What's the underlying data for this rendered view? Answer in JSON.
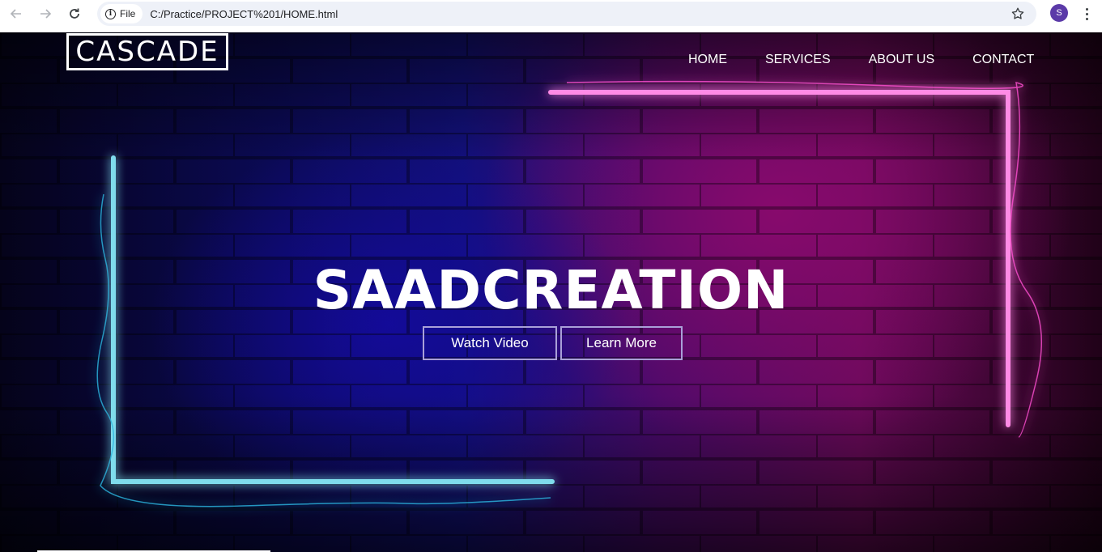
{
  "browser": {
    "site_chip_label": "File",
    "url": "C:/Practice/PROJECT%201/HOME.html",
    "avatar_letter": "S",
    "avatar_color": "#5b3aa8"
  },
  "site": {
    "logo_text": "CASCADE",
    "nav": [
      {
        "label": "HOME"
      },
      {
        "label": "SERVICES"
      },
      {
        "label": "ABOUT US"
      },
      {
        "label": "CONTACT"
      }
    ],
    "hero_title": "SAADCREATION",
    "buttons": {
      "watch_video": "Watch Video",
      "learn_more": "Learn More"
    },
    "colors": {
      "neon_blue": "#3fd0e0",
      "neon_pink": "#ff4fd2",
      "button_border": "#a9a0d8"
    }
  }
}
